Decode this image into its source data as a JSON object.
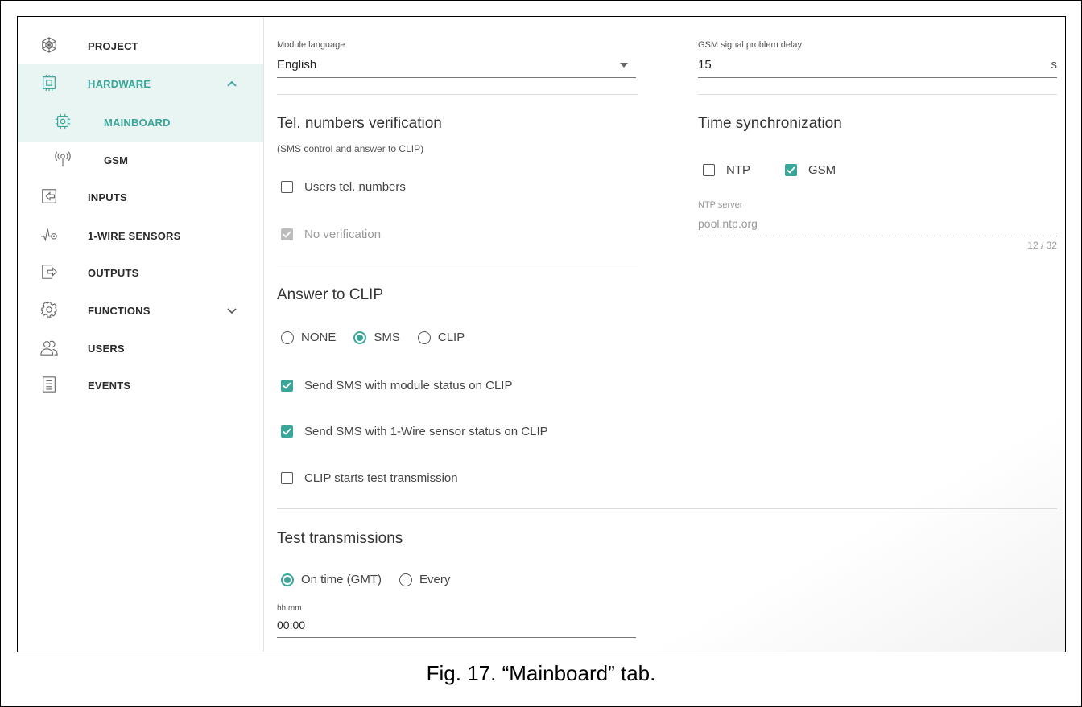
{
  "sidebar": {
    "items": [
      {
        "label": "PROJECT",
        "icon": "project-icon"
      },
      {
        "label": "HARDWARE",
        "icon": "hardware-icon",
        "expanded": true
      },
      {
        "label": "MAINBOARD",
        "icon": "chip-icon",
        "selected": true
      },
      {
        "label": "GSM",
        "icon": "antenna-icon"
      },
      {
        "label": "INPUTS",
        "icon": "input-icon"
      },
      {
        "label": "1-WIRE SENSORS",
        "icon": "sensor-icon"
      },
      {
        "label": "OUTPUTS",
        "icon": "output-icon"
      },
      {
        "label": "FUNCTIONS",
        "icon": "gear-icon",
        "expanded": false
      },
      {
        "label": "USERS",
        "icon": "users-icon"
      },
      {
        "label": "EVENTS",
        "icon": "document-icon"
      }
    ]
  },
  "colors": {
    "accent": "#3aa69a",
    "active_bg": "#e9f5f3"
  },
  "main": {
    "module_language": {
      "label": "Module language",
      "value": "English"
    },
    "gsm_delay": {
      "label": "GSM signal problem delay",
      "value": "15",
      "unit": "s"
    },
    "tel_verification": {
      "title": "Tel. numbers verification",
      "subtitle": "(SMS control and answer to CLIP)",
      "users_numbers": {
        "label": "Users tel. numbers",
        "checked": false
      },
      "no_verification": {
        "label": "No verification",
        "checked": true,
        "disabled": true
      }
    },
    "time_sync": {
      "title": "Time synchronization",
      "ntp": {
        "label": "NTP",
        "checked": false
      },
      "gsm": {
        "label": "GSM",
        "checked": true
      },
      "ntp_server": {
        "label": "NTP server",
        "value": "pool.ntp.org",
        "counter": "12 / 32"
      }
    },
    "answer_clip": {
      "title": "Answer to CLIP",
      "options": [
        "NONE",
        "SMS",
        "CLIP"
      ],
      "selected": "SMS",
      "send_module_status": {
        "label": "Send SMS with module status on CLIP",
        "checked": true
      },
      "send_sensor_status": {
        "label": "Send SMS with 1-Wire sensor status on CLIP",
        "checked": true
      },
      "clip_test": {
        "label": "CLIP starts test transmission",
        "checked": false
      }
    },
    "test_transmissions": {
      "title": "Test transmissions",
      "options": [
        "On time (GMT)",
        "Every"
      ],
      "selected": "On time (GMT)",
      "time": {
        "label": "hh:mm",
        "value": "00:00"
      }
    }
  },
  "caption": "Fig. 17. “Mainboard” tab."
}
